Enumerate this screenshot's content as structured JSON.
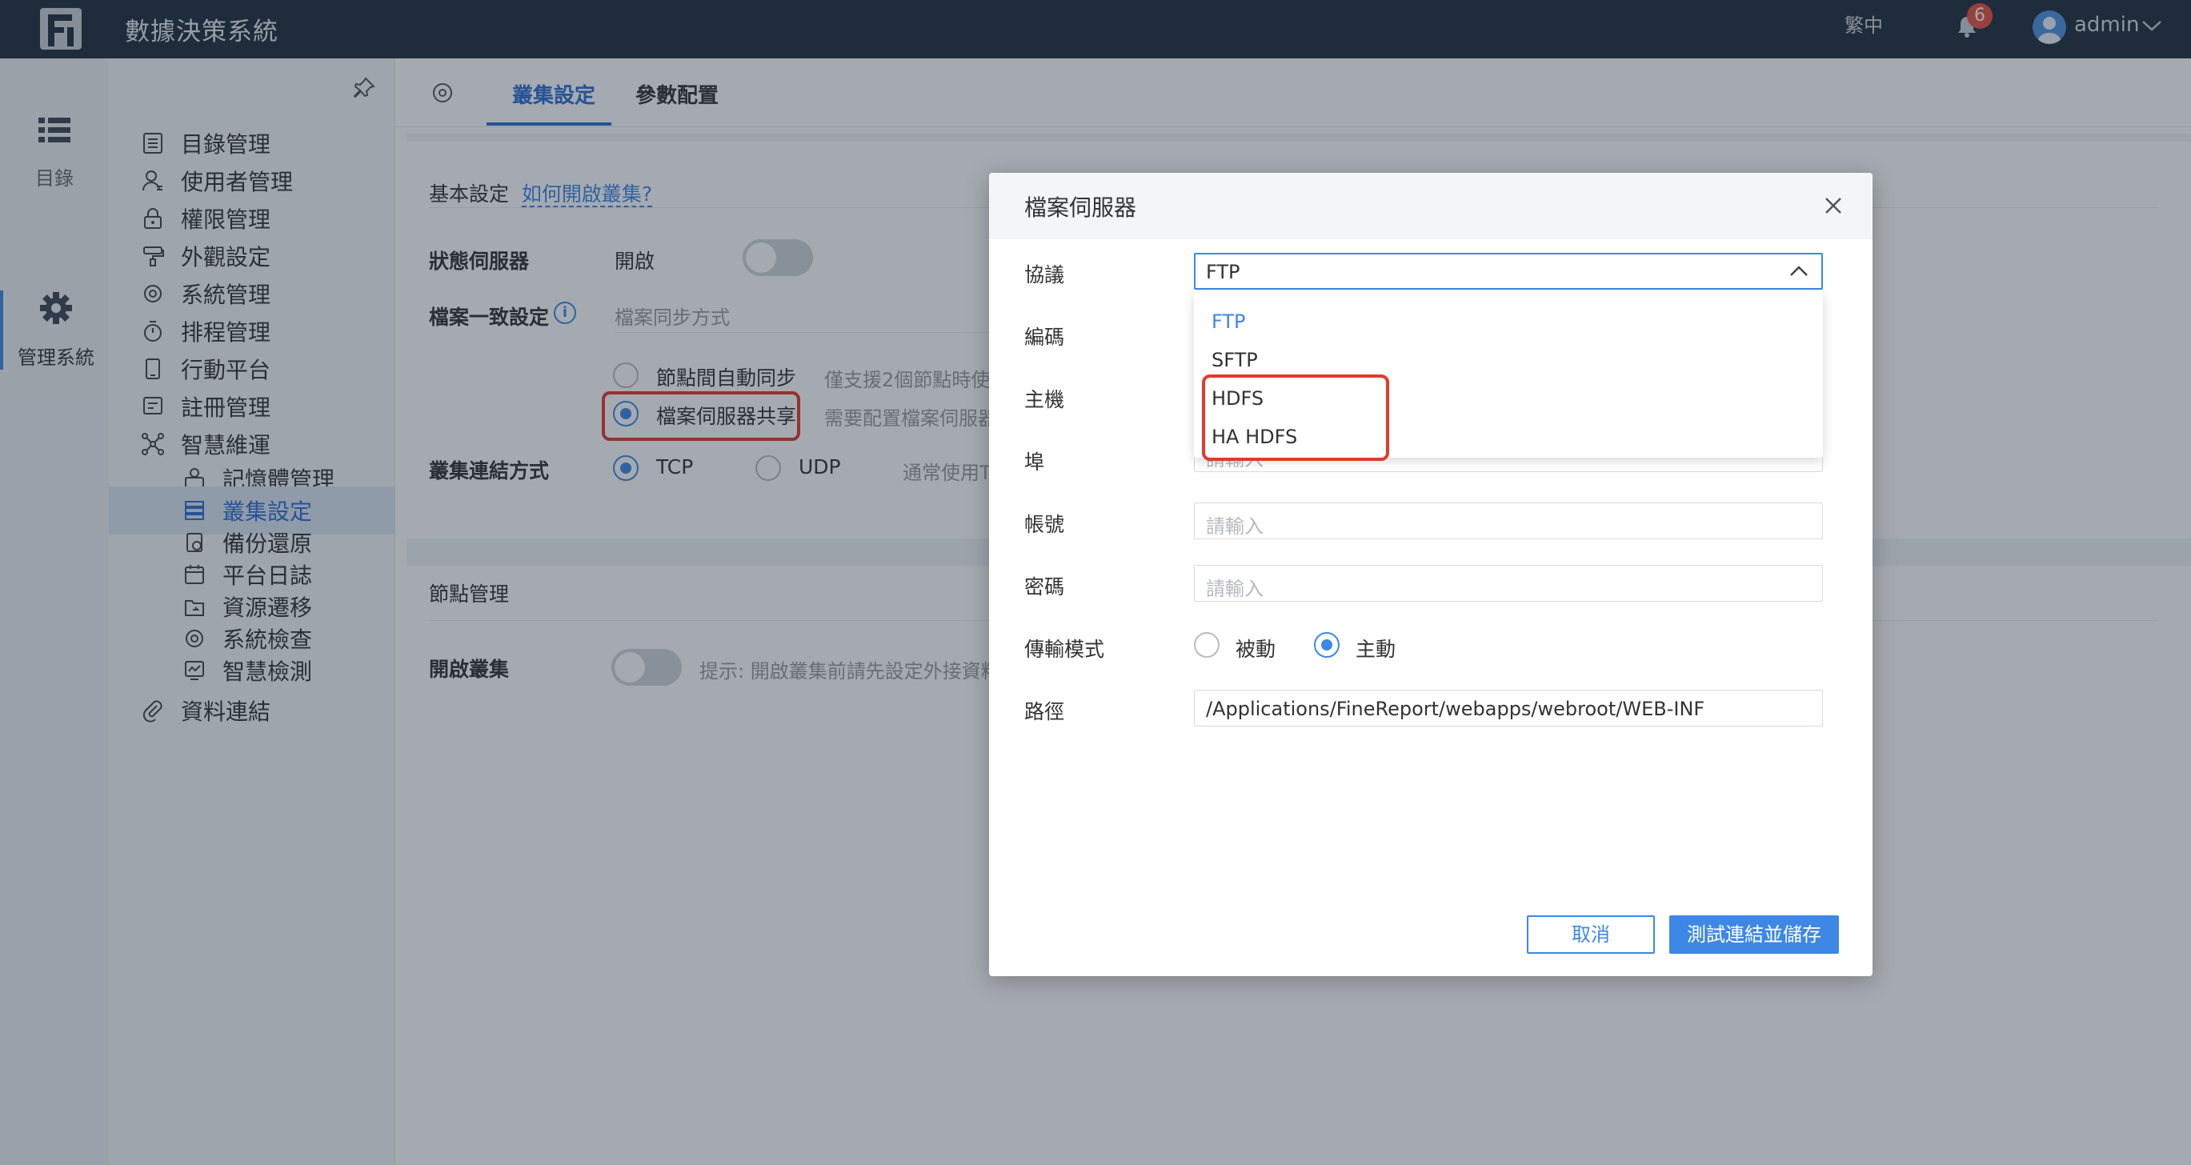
{
  "topbar": {
    "app_title": "數據決策系統",
    "language": "繁中",
    "notification_count": "6",
    "username": "admin"
  },
  "rail": {
    "items": [
      {
        "label": "目錄",
        "icon": "list-icon"
      },
      {
        "label": "管理系統",
        "icon": "gear-icon"
      }
    ]
  },
  "sidebar": {
    "items": [
      {
        "label": "目錄管理",
        "icon": "catalog-icon"
      },
      {
        "label": "使用者管理",
        "icon": "user-icon"
      },
      {
        "label": "權限管理",
        "icon": "lock-icon"
      },
      {
        "label": "外觀設定",
        "icon": "brush-icon"
      },
      {
        "label": "系統管理",
        "icon": "gear-icon"
      },
      {
        "label": "排程管理",
        "icon": "timer-icon"
      },
      {
        "label": "行動平台",
        "icon": "mobile-icon"
      },
      {
        "label": "註冊管理",
        "icon": "register-icon"
      },
      {
        "label": "智慧維運",
        "icon": "network-icon"
      }
    ],
    "sub_items": [
      {
        "label": "記憶體管理",
        "icon": "memory-icon"
      },
      {
        "label": "叢集設定",
        "icon": "cluster-icon"
      },
      {
        "label": "備份還原",
        "icon": "backup-icon"
      },
      {
        "label": "平台日誌",
        "icon": "calendar-icon"
      },
      {
        "label": "資源遷移",
        "icon": "migrate-icon"
      },
      {
        "label": "系統檢查",
        "icon": "check-gear-icon"
      },
      {
        "label": "智慧檢測",
        "icon": "monitor-icon"
      }
    ],
    "bottom_item": {
      "label": "資料連結",
      "icon": "paperclip-icon"
    }
  },
  "main": {
    "tabs": [
      "叢集設定",
      "參數配置"
    ],
    "basic_settings": "基本設定",
    "help_link": "如何開啟叢集?",
    "status_server_label": "狀態伺服器",
    "status_server_value": "開啟",
    "file_consistency_label": "檔案一致設定",
    "file_sync_placeholder": "檔案同步方式",
    "option_node_sync": "節點間自動同步",
    "option_node_sync_hint": "僅支援2個節點時使",
    "option_file_server": "檔案伺服器共享",
    "option_file_server_hint": "需要配置檔案伺服器",
    "cluster_conn_label": "叢集連結方式",
    "conn_tcp": "TCP",
    "conn_udp": "UDP",
    "conn_hint": "通常使用T",
    "node_mgmt": "節點管理",
    "open_cluster_label": "開啟叢集",
    "open_cluster_hint": "提示: 開啟叢集前請先設定外接資料"
  },
  "modal": {
    "title": "檔案伺服器",
    "labels": {
      "protocol": "協議",
      "encoding": "編碼",
      "host": "主機",
      "port": "埠",
      "account": "帳號",
      "password": "密碼",
      "transfer_mode": "傳輸模式",
      "path": "路徑"
    },
    "protocol_value": "FTP",
    "protocol_options": [
      "FTP",
      "SFTP",
      "HDFS",
      "HA HDFS"
    ],
    "port_placeholder_partial": "請輸入",
    "account_placeholder": "請輸入",
    "password_placeholder": "請輸入",
    "mode_passive": "被動",
    "mode_active": "主動",
    "path_value": "/Applications/FineReport/webapps/webroot/WEB-INF",
    "cancel_label": "取消",
    "save_label": "測試連結並儲存"
  },
  "colors": {
    "topbar": "#1f2d3d",
    "accent": "#3d87e6",
    "highlight_box": "#e23a2b",
    "badge": "#e65140"
  }
}
